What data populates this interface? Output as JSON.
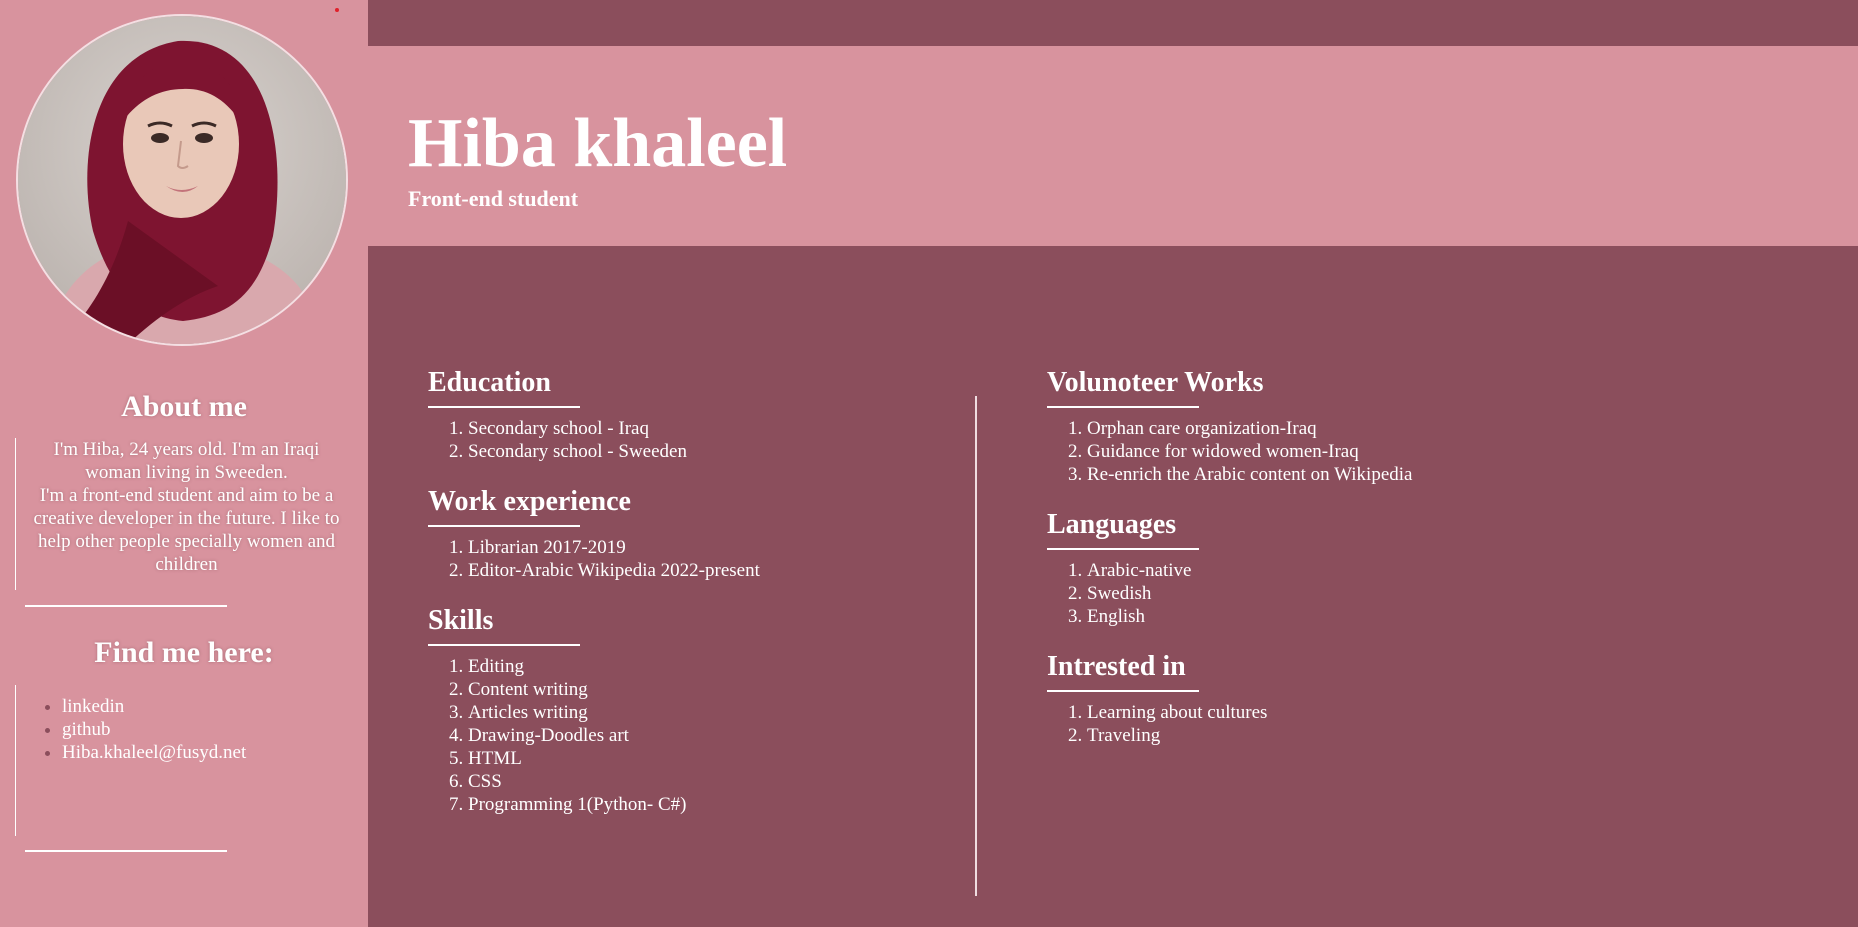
{
  "profile": {
    "name": "Hiba khaleel",
    "role": "Front-end student",
    "photo_icon": "profile-photo"
  },
  "sidebar": {
    "about_heading": "About me",
    "about_lines": [
      "I'm Hiba, 24 years old. I'm an Iraqi woman living in Sweeden.",
      "I'm a front-end student and aim to be a creative developer in the future. I like to help other people specially women and children"
    ],
    "find_heading": "Find me here:",
    "links": [
      "linkedin",
      "github",
      "Hiba.khaleel@fusyd.net"
    ]
  },
  "sections_left": [
    {
      "title": "Education",
      "items": [
        "Secondary school - Iraq",
        "Secondary school - Sweeden"
      ]
    },
    {
      "title": "Work experience",
      "items": [
        "Librarian 2017-2019",
        "Editor-Arabic Wikipedia 2022-present"
      ]
    },
    {
      "title": "Skills",
      "items": [
        "Editing",
        "Content writing",
        "Articles writing",
        "Drawing-Doodles art",
        "HTML",
        "CSS",
        "Programming 1(Python- C#)"
      ]
    }
  ],
  "sections_right": [
    {
      "title": "Volunoteer Works",
      "items": [
        "Orphan care organization-Iraq",
        "Guidance for widowed women-Iraq",
        "Re-enrich the Arabic content on Wikipedia"
      ]
    },
    {
      "title": "Languages",
      "items": [
        "Arabic-native",
        "Swedish",
        "English"
      ]
    },
    {
      "title": "Intrested in",
      "items": [
        "Learning about cultures",
        "Traveling"
      ]
    }
  ],
  "colors": {
    "background": "#8b4e5c",
    "sidebar": "#d8939e",
    "text": "#ffffff"
  }
}
